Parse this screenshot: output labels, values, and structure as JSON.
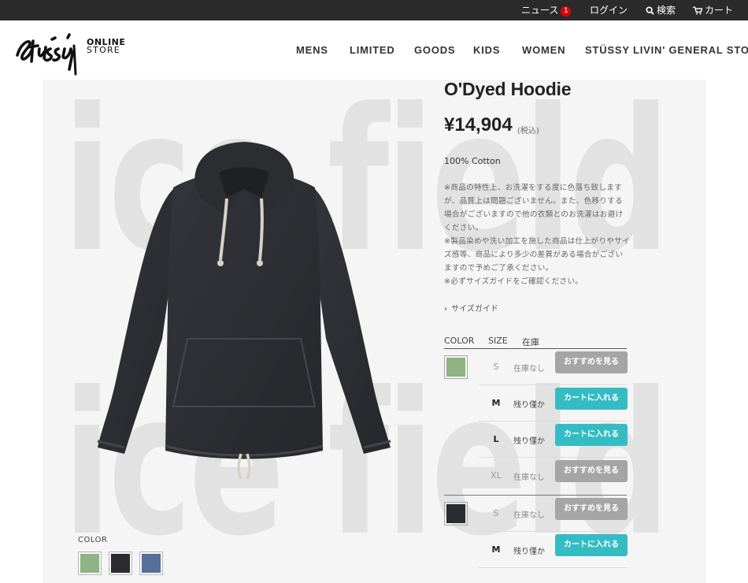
{
  "topbar": {
    "news_label": "ニュース",
    "news_badge": "1",
    "login_label": "ログイン",
    "search_label": "検索",
    "cart_label": "カート"
  },
  "header": {
    "store_line1": "ONLINE",
    "store_line2": "STORE",
    "nav": [
      "MENS",
      "LIMITED",
      "GOODS",
      "KIDS",
      "WOMEN",
      "STÜSSY LIVIN' GENERAL STORE"
    ]
  },
  "gallery": {
    "watermark": [
      "ice field",
      "ice field"
    ],
    "color_label": "COLOR",
    "thumbs": [
      {
        "name": "green",
        "color": "#8fb384"
      },
      {
        "name": "black",
        "color": "#2b2c30"
      },
      {
        "name": "blue",
        "color": "#56709a"
      }
    ]
  },
  "product": {
    "title": "O'Dyed Hoodie",
    "price": "¥14,904",
    "tax_note": "(税込)",
    "material": "100% Cotton",
    "notes": [
      "※商品の特性上、お洗濯をする度に色落ち致しますが、品質上は問題ございません。また、色移りする場合がございますので他の衣類とのお洗濯はお避けください。",
      "※製品染めや洗い加工を施した商品は仕上がりやサイズ感等、商品により多少の差異がある場合がございますので予めご了承ください。",
      "※必ずサイズガイドをご確認ください。"
    ],
    "size_guide": "サイズガイド"
  },
  "stock_table": {
    "headers": {
      "color": "COLOR",
      "size": "SIZE",
      "stock": "在庫"
    },
    "variants": [
      {
        "color_name": "green",
        "swatch_color": "#8fb384",
        "rows": [
          {
            "size": "S",
            "stock": "在庫なし",
            "button": "おすすめを見る"
          },
          {
            "size": "M",
            "stock": "残り僅か",
            "button": "カートに入れる"
          },
          {
            "size": "L",
            "stock": "残り僅か",
            "button": "カートに入れる"
          },
          {
            "size": "XL",
            "stock": "在庫なし",
            "button": "おすすめを見る"
          }
        ]
      },
      {
        "color_name": "black",
        "swatch_color": "#2b2c30",
        "rows": [
          {
            "size": "S",
            "stock": "在庫なし",
            "button": "おすすめを見る"
          },
          {
            "size": "M",
            "stock": "残り僅か",
            "button": "カートに入れる"
          }
        ]
      }
    ]
  },
  "colors": {
    "accent_cart": "#35bcc3",
    "button_disabled": "#a5a5a5",
    "topbar_bg": "#2b2b2b"
  }
}
